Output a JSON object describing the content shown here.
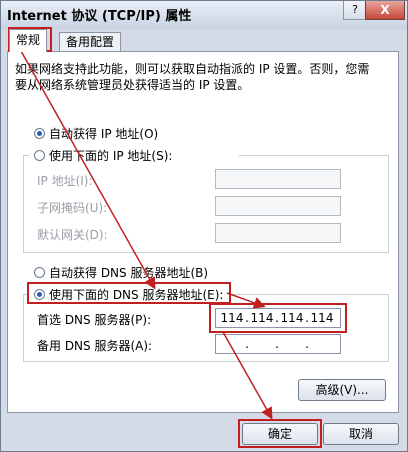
{
  "window": {
    "title": "Internet 协议 (TCP/IP) 属性",
    "help_glyph": "?",
    "close_glyph": "X"
  },
  "tabs": [
    {
      "label": "常规"
    },
    {
      "label": "备用配置"
    }
  ],
  "description": "如果网络支持此功能，则可以获取自动指派的 IP 设置。否则，您需要从网络系统管理员处获得适当的 IP 设置。",
  "ip_section": {
    "auto_label": "自动获得 IP 地址(O)",
    "manual_label": "使用下面的 IP 地址(S):",
    "fields": [
      {
        "label": "IP 地址(I):"
      },
      {
        "label": "子网掩码(U):"
      },
      {
        "label": "默认网关(D):"
      }
    ]
  },
  "dns_section": {
    "auto_label": "自动获得 DNS 服务器地址(B)",
    "manual_label": "使用下面的 DNS 服务器地址(E):",
    "preferred_label": "首选 DNS 服务器(P):",
    "preferred_value": [
      "114",
      "114",
      "114",
      "114"
    ],
    "alternate_label": "备用 DNS 服务器(A):"
  },
  "buttons": {
    "advanced": "高级(V)...",
    "ok": "确定",
    "cancel": "取消"
  },
  "colors": {
    "annotation": "#c22020",
    "selected_radio": "#2a5bb8"
  }
}
